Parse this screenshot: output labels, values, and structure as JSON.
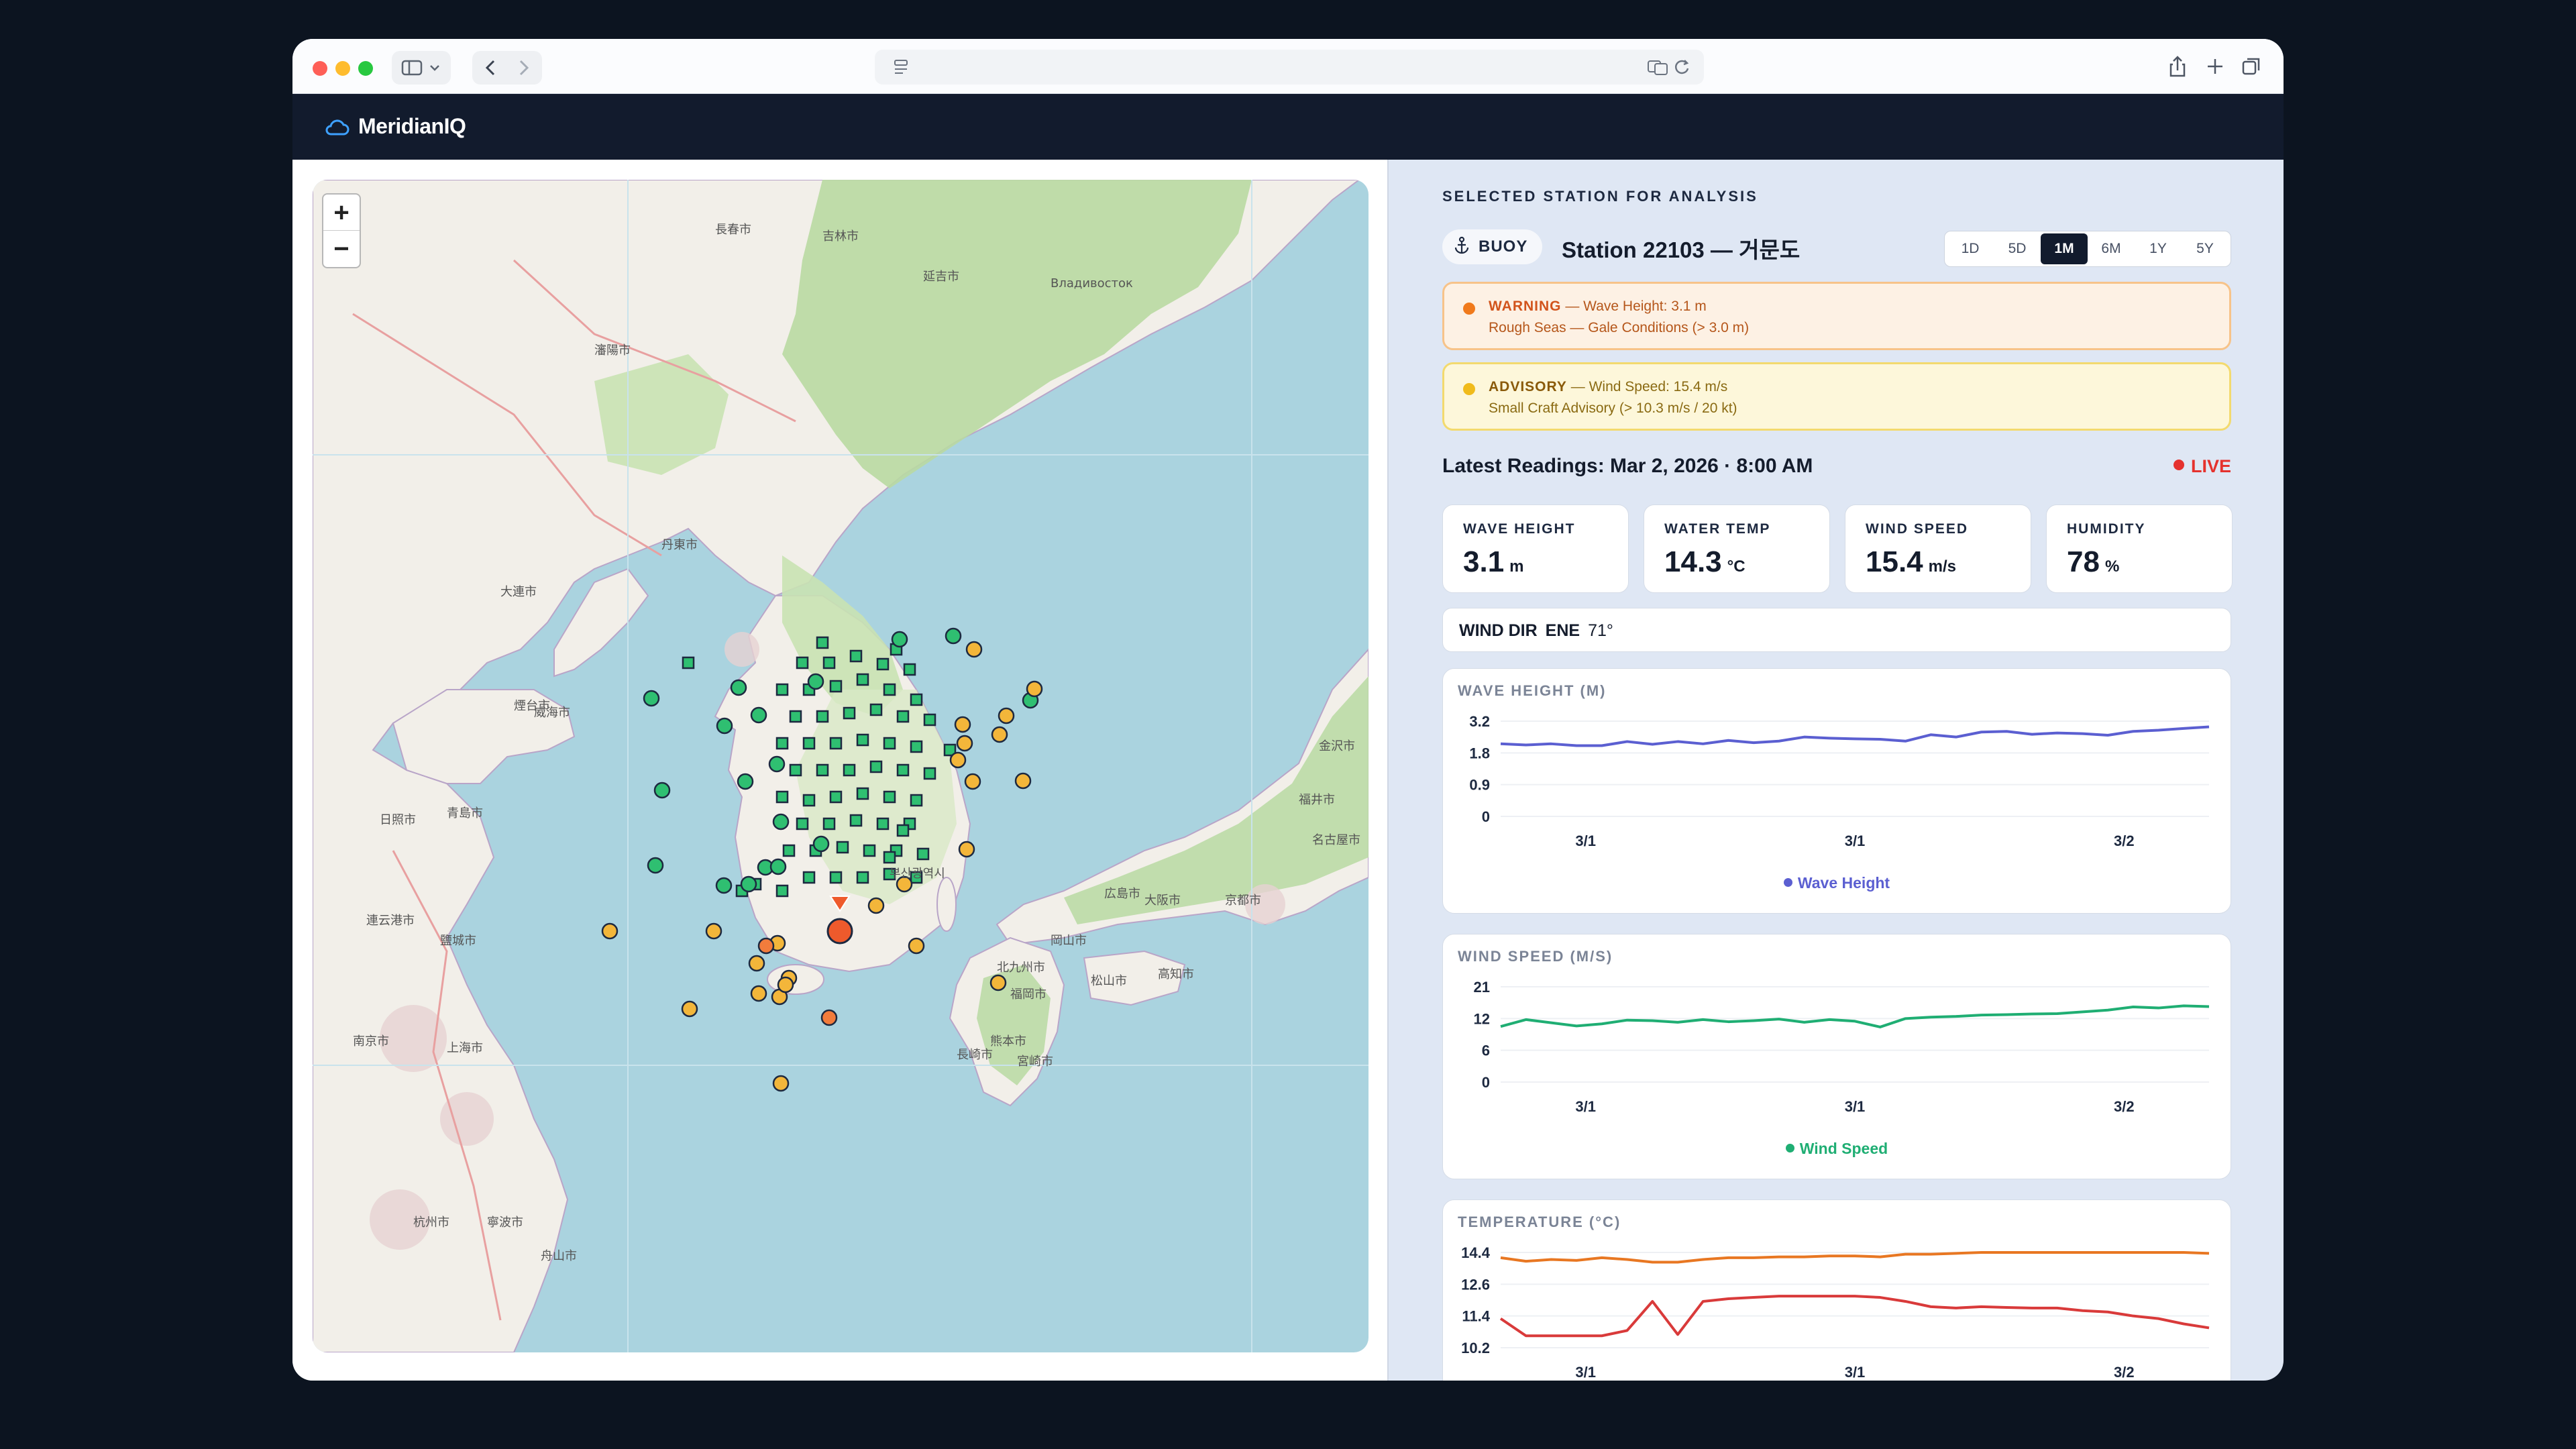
{
  "app": {
    "name": "MeridianIQ"
  },
  "map": {
    "zoom_in": "+",
    "zoom_out": "−",
    "city_labels": [
      "長春市",
      "吉林市",
      "Владивосток",
      "延吉市",
      "瀋陽市",
      "丹東市",
      "大連市",
      "煙台市",
      "威海市",
      "青島市",
      "日照市",
      "連云港市",
      "南京市",
      "上海市",
      "杭州市",
      "寧波市",
      "舟山市",
      "鹽城市",
      "金沢市",
      "福井市",
      "名古屋市",
      "京都市",
      "大阪市",
      "広島市",
      "岡山市",
      "北九州市",
      "福岡市",
      "熊本市",
      "長崎市",
      "宮崎市",
      "松山市",
      "高知市",
      "부산광역시"
    ],
    "colors": {
      "sea": "#aad3df",
      "land": "#f2efe9",
      "forest": "#b9d9a2",
      "urban": "#e6d2d2",
      "ok": "#2fbf71",
      "advisory": "#f3b63a",
      "warning": "#f27c3c",
      "selected": "#ee5a2c"
    }
  },
  "panel": {
    "section_title": "SELECTED STATION FOR ANALYSIS",
    "badge": "BUOY",
    "badge_icon": "anchor-icon",
    "station_name": "Station 22103 — 거문도",
    "ranges": [
      "1D",
      "5D",
      "1M",
      "6M",
      "1Y",
      "5Y"
    ],
    "active_range": "1M",
    "alerts": [
      {
        "level": "WARNING",
        "detail": "— Wave Height: 3.1 m",
        "sub": "Rough Seas — Gale Conditions (> 3.0 m)",
        "color": "#f07a1c",
        "text_color": "#b5561a"
      },
      {
        "level": "ADVISORY",
        "detail": "— Wind Speed: 15.4 m/s",
        "sub": "Small Craft Advisory (> 10.3 m/s / 20 kt)",
        "color": "#f0bb1b",
        "text_color": "#8a6a12"
      }
    ],
    "latest_label": "Latest Readings: Mar 2, 2026 · 8:00 AM",
    "live": "LIVE",
    "metrics": [
      {
        "label": "WAVE HEIGHT",
        "value": "3.1",
        "unit": "m"
      },
      {
        "label": "WATER TEMP",
        "value": "14.3",
        "unit": "°C"
      },
      {
        "label": "WIND SPEED",
        "value": "15.4",
        "unit": "m/s"
      },
      {
        "label": "HUMIDITY",
        "value": "78",
        "unit": "%"
      }
    ],
    "wind_dir": {
      "label": "WIND DIR",
      "value": "ENE",
      "degrees": "71°"
    }
  },
  "chart_data": [
    {
      "type": "line",
      "title": "WAVE HEIGHT (M)",
      "yticks": [
        3.2,
        1.8,
        0.9,
        0
      ],
      "xticks": [
        "3/1",
        "3/1",
        "3/2"
      ],
      "series": [
        {
          "name": "Wave Height",
          "color": "#5b5fd1",
          "values": [
            2.2,
            2.15,
            2.2,
            2.12,
            2.12,
            2.3,
            2.18,
            2.3,
            2.2,
            2.35,
            2.25,
            2.32,
            2.5,
            2.45,
            2.42,
            2.4,
            2.32,
            2.6,
            2.5,
            2.72,
            2.75,
            2.62,
            2.68,
            2.65,
            2.58,
            2.75,
            2.8,
            2.88,
            2.95
          ]
        }
      ]
    },
    {
      "type": "line",
      "title": "WIND SPEED (M/S)",
      "yticks": [
        21,
        12,
        6,
        0
      ],
      "xticks": [
        "3/1",
        "3/1",
        "3/2"
      ],
      "series": [
        {
          "name": "Wind Speed",
          "color": "#1fae73",
          "values": [
            10.5,
            11.8,
            11.2,
            10.6,
            11.0,
            11.7,
            11.6,
            11.3,
            11.8,
            11.4,
            11.6,
            11.9,
            11.3,
            11.8,
            11.5,
            10.4,
            12.0,
            12.4,
            12.6,
            13.0,
            13.1,
            13.3,
            13.4,
            13.9,
            14.4,
            15.3,
            15.0,
            15.6,
            15.4
          ]
        }
      ]
    },
    {
      "type": "line",
      "title": "TEMPERATURE (°C)",
      "yticks": [
        14.4,
        12.6,
        11.4,
        10.2
      ],
      "xticks": [
        "3/1",
        "3/1",
        "3/2"
      ],
      "series": [
        {
          "color": "#e87722",
          "values": [
            14.1,
            13.9,
            14.0,
            13.95,
            14.1,
            14.0,
            13.85,
            13.85,
            14.0,
            14.1,
            14.1,
            14.15,
            14.15,
            14.2,
            14.2,
            14.15,
            14.3,
            14.3,
            14.35,
            14.4,
            14.45,
            14.45,
            14.45,
            14.42,
            14.4,
            14.45,
            14.45,
            14.4,
            14.35
          ]
        },
        {
          "color": "#d93a3a",
          "values": [
            11.3,
            10.65,
            10.65,
            10.65,
            10.65,
            10.85,
            11.95,
            10.7,
            11.95,
            12.05,
            12.1,
            12.15,
            12.15,
            12.15,
            12.15,
            12.1,
            11.95,
            11.75,
            11.7,
            11.75,
            11.72,
            11.7,
            11.7,
            11.6,
            11.55,
            11.4,
            11.3,
            11.1,
            10.95
          ]
        }
      ]
    }
  ]
}
